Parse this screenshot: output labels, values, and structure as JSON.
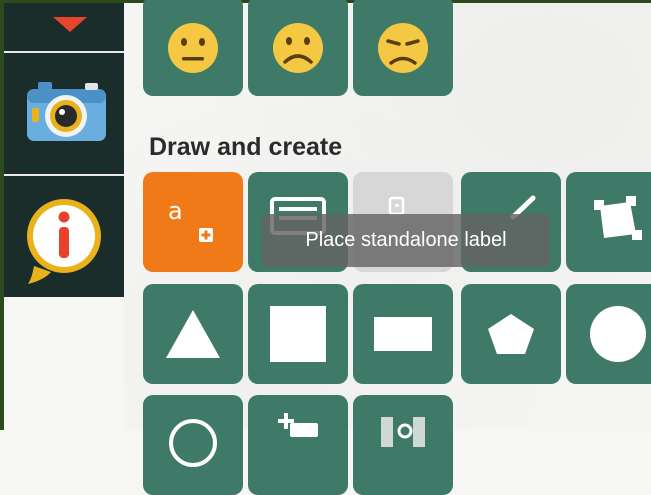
{
  "sidebar": {
    "items": [
      {
        "icon": "location-marker-icon"
      },
      {
        "icon": "camera-icon"
      },
      {
        "icon": "info-icon"
      }
    ]
  },
  "emoji_row": [
    {
      "icon": "neutral-face-icon"
    },
    {
      "icon": "frowning-face-icon"
    },
    {
      "icon": "unamused-face-icon"
    }
  ],
  "draw_section": {
    "title": "Draw and create",
    "label_tool_letter": "a",
    "tooltip": "Place standalone label"
  },
  "colors": {
    "sidebar_bg": "#1b2d2a",
    "tool_bg": "#3f7a68",
    "active_tool_bg": "#f07a18",
    "emoji_yellow": "#f4c842"
  }
}
